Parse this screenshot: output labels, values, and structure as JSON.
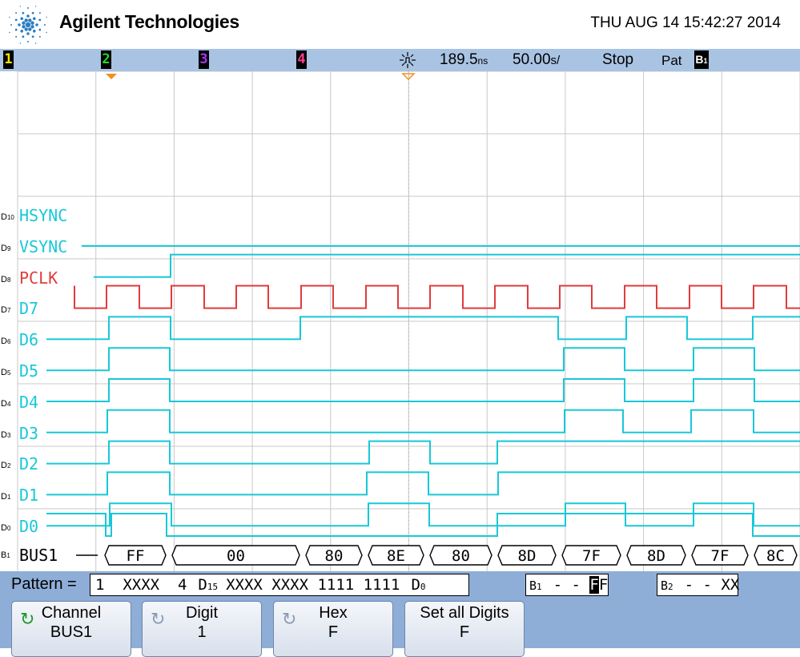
{
  "header": {
    "brand": "Agilent Technologies",
    "datetime": "THU AUG 14 15:42:27 2014"
  },
  "status": {
    "channels": [
      {
        "label": "1",
        "color": "#f2e400"
      },
      {
        "label": "2",
        "color": "#22d822"
      },
      {
        "label": "3",
        "color": "#b030ff"
      },
      {
        "label": "4",
        "color": "#ff3c8c"
      }
    ],
    "trigger_icon": "trigger-icon",
    "delay": "189.5",
    "delay_unit": "ns",
    "timebase": "50.00",
    "timebase_unit": "s/",
    "run_state": "Stop",
    "pat_label": "Pat",
    "pat_badge": "B",
    "pat_badge_sub": "1"
  },
  "waveforms": {
    "digital_color": "#18c8d8",
    "clock_color": "#e03c3c",
    "channels": [
      {
        "chan": "D10",
        "label": "HSYNC",
        "row": 0
      },
      {
        "chan": "D9",
        "label": "VSYNC",
        "row": 1
      },
      {
        "chan": "D8",
        "label": "PCLK",
        "row": 2
      },
      {
        "chan": "D7",
        "label": "D7",
        "row": 3
      },
      {
        "chan": "D6",
        "label": "D6",
        "row": 4
      },
      {
        "chan": "D5",
        "label": "D5",
        "row": 5
      },
      {
        "chan": "D4",
        "label": "D4",
        "row": 6
      },
      {
        "chan": "D3",
        "label": "D3",
        "row": 7
      },
      {
        "chan": "D2",
        "label": "D2",
        "row": 8
      },
      {
        "chan": "D1",
        "label": "D1",
        "row": 9
      },
      {
        "chan": "D0",
        "label": "D0",
        "row": 10
      }
    ],
    "bus": {
      "chan": "B1",
      "label": "BUS1",
      "values": [
        "FF",
        "00",
        "80",
        "8E",
        "80",
        "8D",
        "7F",
        "8D",
        "7F",
        "8C"
      ]
    }
  },
  "pattern": {
    "label": "Pattern =",
    "value1": "1  XXXX  4",
    "d15_label": "D",
    "d15_sub": "15",
    "bits": "XXXX XXXX 1111 1111",
    "d0_label": "D",
    "d0_sub": "0",
    "b1_label": "B",
    "b1_sub": "1",
    "b1_value_prefix": "- - ",
    "b1_value_cursor": "F",
    "b1_value_suffix": "F",
    "b2_label": "B",
    "b2_sub": "2",
    "b2_value": "- - XX"
  },
  "softkeys": [
    {
      "line1": "Channel",
      "line2": "BUS1",
      "knob": "rotate-knob-icon",
      "active": true
    },
    {
      "line1": "Digit",
      "line2": "1",
      "knob": "rotate-knob-icon",
      "active": false
    },
    {
      "line1": "Hex",
      "line2": "F",
      "knob": "rotate-knob-icon",
      "active": false
    },
    {
      "line1": "Set all Digits",
      "line2": "F",
      "knob": "",
      "active": false
    }
  ]
}
